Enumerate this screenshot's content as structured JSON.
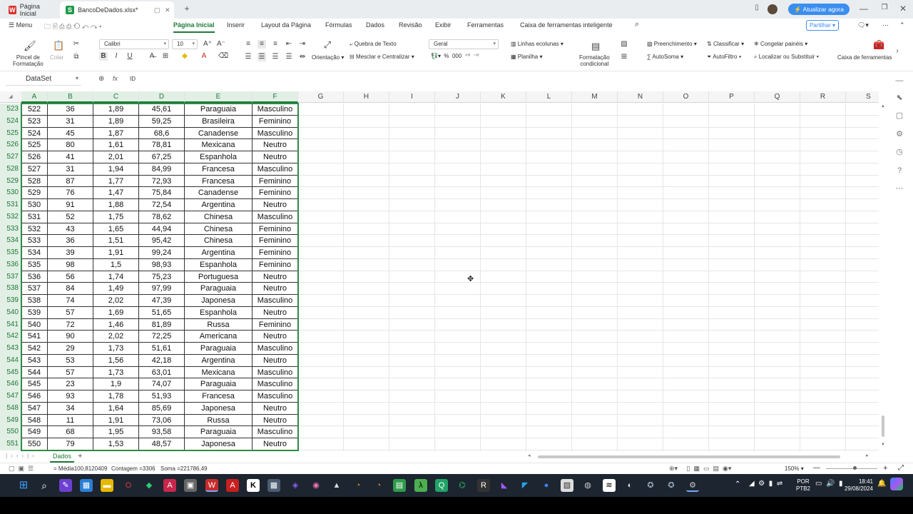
{
  "titlebar": {
    "tabs": [
      {
        "label": "Página Inicial",
        "icon": "wps-logo-icon"
      },
      {
        "label": "BancoDeDados.xlsx*",
        "icon": "spreadsheet-logo-icon"
      }
    ],
    "update_label": "Atualizar agora"
  },
  "menu": {
    "menu_label": "Menu",
    "tabs": [
      "Página Inicial",
      "Inserir",
      "Layout da Página",
      "Fórmulas",
      "Dados",
      "Revisão",
      "Exibir",
      "Ferramentas",
      "Caixa de ferramentas inteligente"
    ],
    "share_label": "Partilhar"
  },
  "ribbon": {
    "format_painter": "Pincel de\nFormatação",
    "paste": "Colar",
    "font_name": "Calibri",
    "font_size": "10",
    "wrap_text": "Quebra de Texto",
    "merge_center": "Mesclar e Centralizar",
    "orientation": "Orientação",
    "number_format": "Geral",
    "rows_columns": "Linhas ecolunas",
    "worksheet": "Planilha",
    "conditional_format": "Formatação\ncondicional",
    "fill": "Preenchimento",
    "autosum": "AutoSoma",
    "sort": "Classificar",
    "autofilter": "AutoFiltro",
    "freeze_panes": "Congelar painéis",
    "find_replace": "Localizar ou Substituir",
    "toolbox": "Caixa de ferramentas"
  },
  "formula_bar": {
    "name_box": "DataSet",
    "fx": "fx",
    "content": "ID"
  },
  "columns": [
    "A",
    "B",
    "C",
    "D",
    "E",
    "F",
    "G",
    "H",
    "I",
    "J",
    "K",
    "L",
    "M",
    "N",
    "O",
    "P",
    "Q",
    "R",
    "S"
  ],
  "rows": [
    {
      "n": "523",
      "a": "522",
      "b": "36",
      "c": "1,89",
      "d": "45,61",
      "e": "Paraguaia",
      "f": "Masculino"
    },
    {
      "n": "524",
      "a": "523",
      "b": "31",
      "c": "1,89",
      "d": "59,25",
      "e": "Brasileira",
      "f": "Feminino"
    },
    {
      "n": "525",
      "a": "524",
      "b": "45",
      "c": "1,87",
      "d": "68,6",
      "e": "Canadense",
      "f": "Masculino"
    },
    {
      "n": "526",
      "a": "525",
      "b": "80",
      "c": "1,61",
      "d": "78,81",
      "e": "Mexicana",
      "f": "Neutro"
    },
    {
      "n": "527",
      "a": "526",
      "b": "41",
      "c": "2,01",
      "d": "67,25",
      "e": "Espanhola",
      "f": "Neutro"
    },
    {
      "n": "528",
      "a": "527",
      "b": "31",
      "c": "1,94",
      "d": "84,99",
      "e": "Francesa",
      "f": "Masculino"
    },
    {
      "n": "529",
      "a": "528",
      "b": "87",
      "c": "1,77",
      "d": "72,93",
      "e": "Francesa",
      "f": "Feminino"
    },
    {
      "n": "530",
      "a": "529",
      "b": "76",
      "c": "1,47",
      "d": "75,84",
      "e": "Canadense",
      "f": "Feminino"
    },
    {
      "n": "531",
      "a": "530",
      "b": "91",
      "c": "1,88",
      "d": "72,54",
      "e": "Argentina",
      "f": "Neutro"
    },
    {
      "n": "532",
      "a": "531",
      "b": "52",
      "c": "1,75",
      "d": "78,62",
      "e": "Chinesa",
      "f": "Masculino"
    },
    {
      "n": "533",
      "a": "532",
      "b": "43",
      "c": "1,65",
      "d": "44,94",
      "e": "Chinesa",
      "f": "Feminino"
    },
    {
      "n": "534",
      "a": "533",
      "b": "36",
      "c": "1,51",
      "d": "95,42",
      "e": "Chinesa",
      "f": "Feminino"
    },
    {
      "n": "535",
      "a": "534",
      "b": "39",
      "c": "1,91",
      "d": "99,24",
      "e": "Argentina",
      "f": "Feminino"
    },
    {
      "n": "536",
      "a": "535",
      "b": "98",
      "c": "1,5",
      "d": "98,93",
      "e": "Espanhola",
      "f": "Feminino"
    },
    {
      "n": "537",
      "a": "536",
      "b": "56",
      "c": "1,74",
      "d": "75,23",
      "e": "Portuguesa",
      "f": "Neutro"
    },
    {
      "n": "538",
      "a": "537",
      "b": "84",
      "c": "1,49",
      "d": "97,99",
      "e": "Paraguaia",
      "f": "Neutro"
    },
    {
      "n": "539",
      "a": "538",
      "b": "74",
      "c": "2,02",
      "d": "47,39",
      "e": "Japonesa",
      "f": "Masculino"
    },
    {
      "n": "540",
      "a": "539",
      "b": "57",
      "c": "1,69",
      "d": "51,65",
      "e": "Espanhola",
      "f": "Neutro"
    },
    {
      "n": "541",
      "a": "540",
      "b": "72",
      "c": "1,46",
      "d": "81,89",
      "e": "Russa",
      "f": "Feminino"
    },
    {
      "n": "542",
      "a": "541",
      "b": "90",
      "c": "2,02",
      "d": "72,25",
      "e": "Americana",
      "f": "Neutro"
    },
    {
      "n": "543",
      "a": "542",
      "b": "29",
      "c": "1,73",
      "d": "51,61",
      "e": "Paraguaia",
      "f": "Masculino"
    },
    {
      "n": "544",
      "a": "543",
      "b": "53",
      "c": "1,56",
      "d": "42,18",
      "e": "Argentina",
      "f": "Neutro"
    },
    {
      "n": "545",
      "a": "544",
      "b": "57",
      "c": "1,73",
      "d": "63,01",
      "e": "Mexicana",
      "f": "Masculino"
    },
    {
      "n": "546",
      "a": "545",
      "b": "23",
      "c": "1,9",
      "d": "74,07",
      "e": "Paraguaia",
      "f": "Masculino"
    },
    {
      "n": "547",
      "a": "546",
      "b": "93",
      "c": "1,78",
      "d": "51,93",
      "e": "Francesa",
      "f": "Masculino"
    },
    {
      "n": "548",
      "a": "547",
      "b": "34",
      "c": "1,64",
      "d": "85,69",
      "e": "Japonesa",
      "f": "Neutro"
    },
    {
      "n": "549",
      "a": "548",
      "b": "11",
      "c": "1,91",
      "d": "73,06",
      "e": "Russa",
      "f": "Neutro"
    },
    {
      "n": "550",
      "a": "549",
      "b": "68",
      "c": "1,95",
      "d": "93,58",
      "e": "Paraguaia",
      "f": "Masculino"
    },
    {
      "n": "551",
      "a": "550",
      "b": "79",
      "c": "1,53",
      "d": "48,57",
      "e": "Japonesa",
      "f": "Neutro"
    }
  ],
  "sheet_tabs": [
    "Dados"
  ],
  "status": {
    "average": "Média100,8120409",
    "count": "Contagem =3306",
    "sum": "Soma =221786,49",
    "zoom": "150%"
  },
  "tray": {
    "lang": "POR",
    "layout": "PTB2",
    "time": "18:41",
    "date": "29/08/2024"
  },
  "colors": {
    "accent_green": "#1f7a3a",
    "update_blue": "#3b8ef0",
    "taskbar": "#1d2530"
  }
}
